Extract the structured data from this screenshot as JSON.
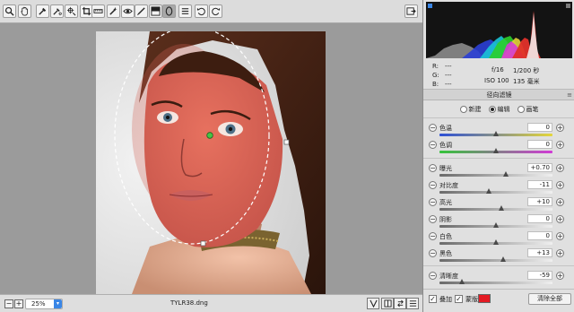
{
  "toolbar": {
    "tools": [
      "zoom-icon",
      "hand-icon",
      "white-balance-icon",
      "color-sampler-icon",
      "targeted-adjust-icon",
      "crop-icon",
      "straighten-icon",
      "spot-removal-icon",
      "red-eye-icon",
      "adjustment-brush-icon",
      "graduated-filter-icon",
      "radial-filter-icon",
      "preferences-icon",
      "rotate-ccw-icon",
      "rotate-cw-icon"
    ]
  },
  "status": {
    "zoom": "25%",
    "filename": "TYLR38.dng"
  },
  "info": {
    "r_label": "R:",
    "r_value": "---",
    "g_label": "G:",
    "g_value": "---",
    "b_label": "B:",
    "b_value": "---",
    "aperture": "f/16",
    "shutter": "1/200 秒",
    "iso": "ISO 100",
    "focal": "135 毫米"
  },
  "panel": {
    "title": "径向滤镜",
    "modes": [
      "新建",
      "编辑",
      "画笔"
    ],
    "selected_mode": "编辑"
  },
  "sliders": [
    {
      "label": "色温",
      "value": "0",
      "pos": 0.5,
      "track": "temp"
    },
    {
      "label": "色调",
      "value": "0",
      "pos": 0.5,
      "track": "tint"
    },
    {
      "label": "曝光",
      "value": "+0.70",
      "pos": 0.59,
      "track": "gray"
    },
    {
      "label": "对比度",
      "value": "-11",
      "pos": 0.44,
      "track": "gray"
    },
    {
      "label": "高光",
      "value": "+10",
      "pos": 0.55,
      "track": "gray"
    },
    {
      "label": "阴影",
      "value": "0",
      "pos": 0.5,
      "track": "gray"
    },
    {
      "label": "白色",
      "value": "0",
      "pos": 0.5,
      "track": "gray"
    },
    {
      "label": "黑色",
      "value": "+13",
      "pos": 0.565,
      "track": "gray"
    },
    {
      "label": "清晰度",
      "value": "-59",
      "pos": 0.2,
      "track": "gray"
    }
  ],
  "bottom": {
    "overlay_label": "叠加",
    "overlay_checked": true,
    "mask_label": "蒙版",
    "mask_checked": true,
    "mask_color": "#e31b23",
    "clear_all": "清除全部"
  },
  "colors": {
    "accent": "#3a86e6",
    "mask_red": "#e31b23"
  }
}
